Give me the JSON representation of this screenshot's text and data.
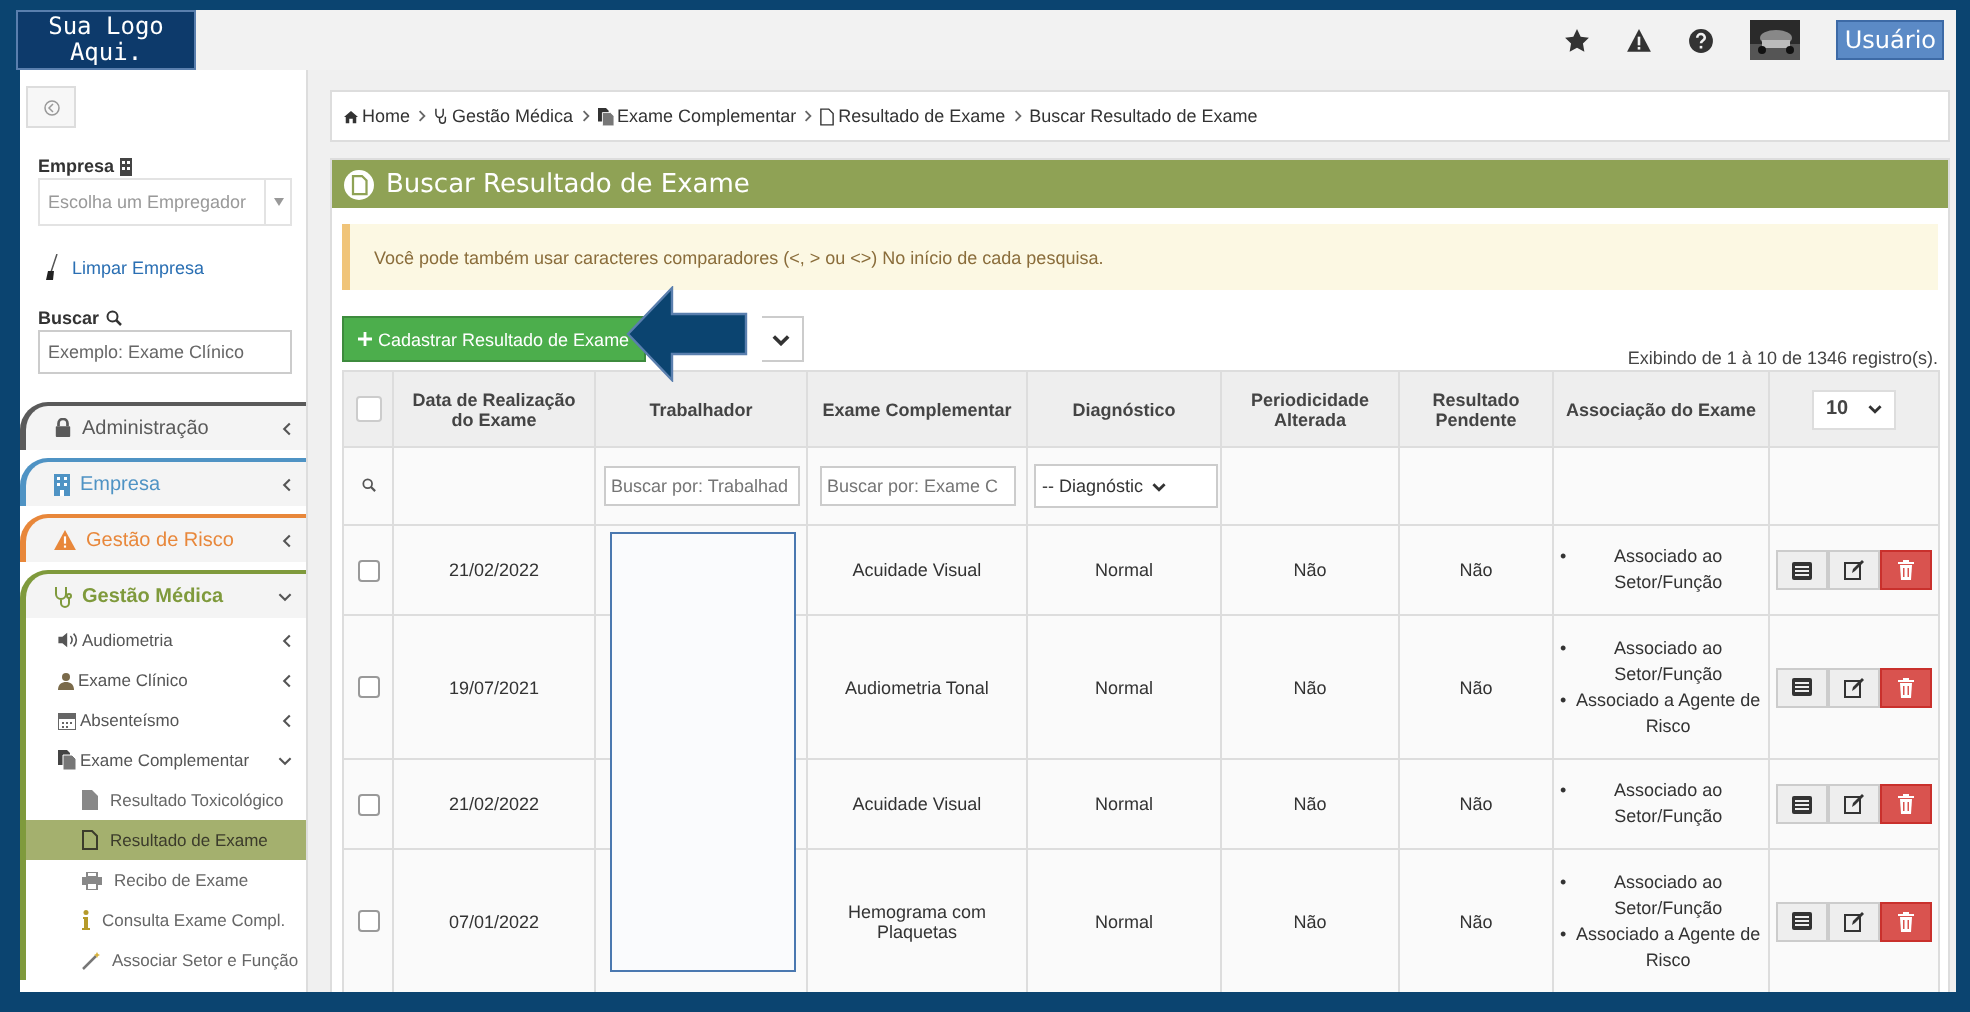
{
  "logo": "Sua Logo Aqui.",
  "topbar": {
    "user_button": "Usuário"
  },
  "sidebar": {
    "company_label": "Empresa",
    "company_select": {
      "placeholder": "Escolha um Empregador"
    },
    "clear_link": "Limpar Empresa",
    "search_label": "Buscar",
    "search": {
      "placeholder": "Exemplo: Exame Clínico"
    },
    "menu": [
      {
        "label": "Administração",
        "color": "#5a5a5a",
        "expanded": false
      },
      {
        "label": "Empresa",
        "color": "#4f93c4",
        "expanded": false
      },
      {
        "label": "Gestão de Risco",
        "color": "#e8873a",
        "expanded": false
      },
      {
        "label": "Gestão Médica",
        "color": "#7f9a3c",
        "expanded": true,
        "children": [
          {
            "label": "Audiometria",
            "expanded": false
          },
          {
            "label": "Exame Clínico",
            "expanded": false
          },
          {
            "label": "Absenteísmo",
            "expanded": false
          },
          {
            "label": "Exame Complementar",
            "expanded": true,
            "children": [
              {
                "label": "Resultado Toxicológico",
                "selected": false
              },
              {
                "label": "Resultado de Exame",
                "selected": true
              },
              {
                "label": "Recibo de Exame",
                "selected": false
              },
              {
                "label": "Consulta Exame Compl.",
                "selected": false
              },
              {
                "label": "Associar Setor e Função",
                "selected": false
              }
            ]
          }
        ]
      }
    ]
  },
  "breadcrumb": [
    "Home",
    "Gestão Médica",
    "Exame Complementar",
    "Resultado de Exame",
    "Buscar Resultado de Exame"
  ],
  "panel": {
    "title": "Buscar Resultado de Exame",
    "alert": "Você pode também usar caracteres comparadores (<, > ou <>) No início de cada pesquisa.",
    "add_button": "Cadastrar Resultado de Exame",
    "record_count": "Exibindo de 1 à 10 de 1346 registro(s).",
    "table": {
      "columns": [
        "Data de Realização do Exame",
        "Trabalhador",
        "Exame Complementar",
        "Diagnóstico",
        "Periodicidade Alterada",
        "Resultado Pendente",
        "Associação do Exame"
      ],
      "select_all_checked": false,
      "bullet": "•",
      "page_size": "10",
      "filters": {
        "worker": {
          "placeholder": "Buscar por: Trabalhad"
        },
        "exam": {
          "placeholder": "Buscar por: Exame C"
        },
        "diagnosis": "-- Diagnóstic"
      },
      "rows": [
        {
          "checked": false,
          "date": "21/02/2022",
          "exam": "Acuidade Visual",
          "diagnosis": "Normal",
          "periodicity_changed": "Não",
          "result_pending": "Não",
          "associations": [
            "Associado ao Setor/Função"
          ]
        },
        {
          "checked": false,
          "date": "19/07/2021",
          "exam": "Audiometria Tonal",
          "diagnosis": "Normal",
          "periodicity_changed": "Não",
          "result_pending": "Não",
          "associations": [
            "Associado ao Setor/Função",
            "Associado a Agente de Risco"
          ]
        },
        {
          "checked": false,
          "date": "21/02/2022",
          "exam": "Acuidade Visual",
          "diagnosis": "Normal",
          "periodicity_changed": "Não",
          "result_pending": "Não",
          "associations": [
            "Associado ao Setor/Função"
          ]
        },
        {
          "checked": false,
          "date": "07/01/2022",
          "exam": "Hemograma com Plaquetas",
          "diagnosis": "Normal",
          "periodicity_changed": "Não",
          "result_pending": "Não",
          "associations": [
            "Associado ao Setor/Função",
            "Associado a Agente de Risco"
          ]
        }
      ]
    }
  }
}
